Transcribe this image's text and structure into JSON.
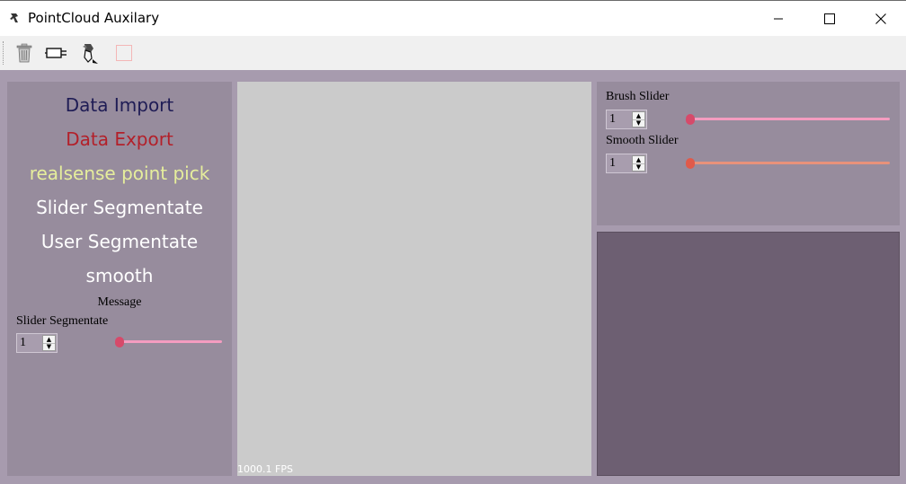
{
  "window": {
    "title": "PointCloud Auxilary"
  },
  "toolbar": {
    "tools": [
      {
        "icon": "trash-icon"
      },
      {
        "icon": "plug-icon"
      },
      {
        "icon": "brush-icon"
      },
      {
        "icon": "color-swatch-icon"
      }
    ]
  },
  "left_panel": {
    "menu": [
      {
        "label": "Data Import",
        "color": "#1f1c55"
      },
      {
        "label": "Data Export",
        "color": "#b3202a"
      },
      {
        "label": "realsense point pick",
        "color": "#e6ee9c"
      },
      {
        "label": "Slider Segmentate",
        "color": "#ffffff"
      },
      {
        "label": "User Segmentate",
        "color": "#ffffff"
      },
      {
        "label": "smooth",
        "color": "#ffffff"
      }
    ],
    "message_label": "Message",
    "slider_label": "Slider Segmentate",
    "spin_value": "1",
    "slider_value": 1,
    "slider_color": "#f49cc0",
    "handle_color": "#d64a6a"
  },
  "viewport": {
    "fps": "1000.1 FPS"
  },
  "right_panel": {
    "brush": {
      "label": "Brush Slider",
      "spin_value": "1",
      "slider_value": 1,
      "track_color": "#f49cc0",
      "handle_color": "#d64a6a"
    },
    "smooth": {
      "label": "Smooth Slider",
      "spin_value": "1",
      "slider_value": 1,
      "track_color": "#e8927a",
      "handle_color": "#e05a4a"
    }
  }
}
